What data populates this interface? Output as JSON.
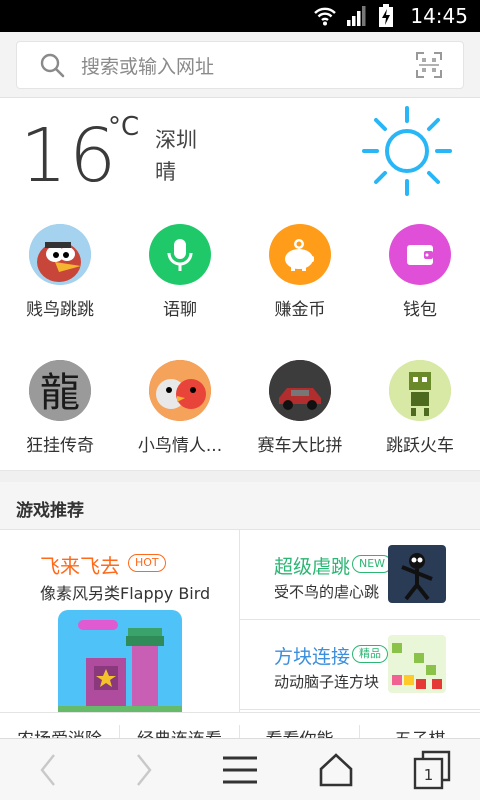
{
  "status_bar": {
    "time": "14:45"
  },
  "search": {
    "placeholder": "搜索或输入网址"
  },
  "weather": {
    "temperature": "16",
    "unit": "°C",
    "city": "深圳",
    "condition": "晴"
  },
  "apps": [
    {
      "label": "贱鸟跳跳",
      "icon": "angry-bird-icon",
      "color": "#e85a4f"
    },
    {
      "label": "语聊",
      "icon": "microphone-icon",
      "color": "#1fc96a"
    },
    {
      "label": "赚金币",
      "icon": "piggy-bank-icon",
      "color": "#ff9c1a"
    },
    {
      "label": "钱包",
      "icon": "wallet-icon",
      "color": "#e04fd7"
    },
    {
      "label": "狂挂传奇",
      "icon": "dragon-character-icon",
      "color": "#555555"
    },
    {
      "label": "小鸟情人...",
      "icon": "bird-lovers-icon",
      "color": "#f26b3a"
    },
    {
      "label": "赛车大比拼",
      "icon": "race-car-icon",
      "color": "#6b2a2a"
    },
    {
      "label": "跳跃火车",
      "icon": "pixel-robot-icon",
      "color": "#c9e08a"
    }
  ],
  "games_section": {
    "title": "游戏推荐",
    "featured": {
      "name": "飞来飞去",
      "badge": "HOT",
      "desc": "像素风另类Flappy Bird"
    },
    "items": [
      {
        "name": "超级虐跳",
        "badge": "NEW",
        "desc": "受不鸟的虐心跳",
        "name_color": "#2bb673",
        "badge_color": "#2bb673"
      },
      {
        "name": "方块连接",
        "badge": "精品",
        "desc": "动动脑子连方块",
        "name_color": "#3b8fdd",
        "badge_color": "#2bb673"
      }
    ],
    "tabs": [
      "农场爱消除",
      "经典连连看",
      "看看你能",
      "五子棋"
    ]
  },
  "bottom_nav": {
    "tab_count": "1"
  },
  "colors": {
    "accent": "#ff6a1a",
    "sun": "#29b6f6"
  }
}
